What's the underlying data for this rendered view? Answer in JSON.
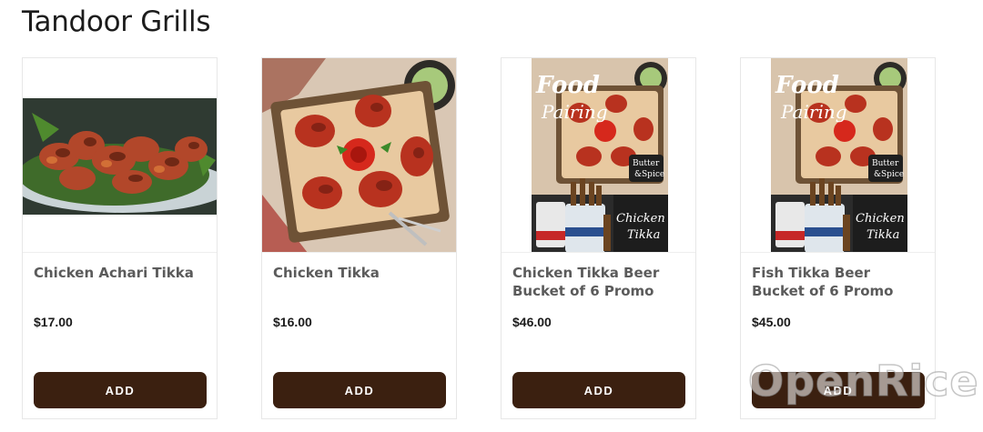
{
  "section": {
    "title": "Tandoor Grills"
  },
  "products": [
    {
      "name": "Chicken Achari Tikka",
      "price": "$17.00",
      "add_label": "ADD",
      "image_icon": "chicken-achari-tikka-photo"
    },
    {
      "name": "Chicken Tikka",
      "price": "$16.00",
      "add_label": "ADD",
      "image_icon": "chicken-tikka-photo"
    },
    {
      "name": "Chicken Tikka Beer Bucket of 6 Promo",
      "price": "$46.00",
      "add_label": "ADD",
      "image_icon": "food-pairing-poster",
      "poster": {
        "headline1": "Food",
        "headline2": "Pairing",
        "brand1": "Butter",
        "brand2": "&Spice",
        "caption1": "Chicken",
        "caption2": "Tikka"
      }
    },
    {
      "name": "Fish Tikka Beer Bucket of 6 Promo",
      "price": "$45.00",
      "add_label": "ADD",
      "image_icon": "food-pairing-poster",
      "poster": {
        "headline1": "Food",
        "headline2": "Pairing",
        "brand1": "Butter",
        "brand2": "&Spice",
        "caption1": "Chicken",
        "caption2": "Tikka"
      }
    }
  ],
  "watermark": {
    "text": "OpenRice"
  },
  "colors": {
    "button": "#3b2010",
    "title": "#1c1c1c",
    "product_name": "#5b5b5b",
    "price": "#1b1b1b"
  }
}
